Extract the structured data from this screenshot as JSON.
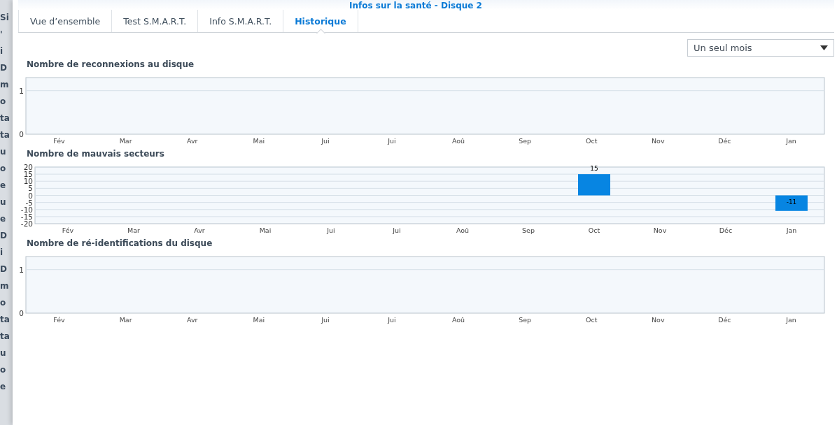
{
  "window": {
    "title": "Infos sur la santé - Disque 2"
  },
  "background_fragments": [
    "Si",
    "'",
    "i",
    "D",
    "m",
    "o",
    "ta",
    "ta",
    "u",
    "o",
    "e",
    "u",
    "e",
    "D",
    "i",
    "D",
    "m",
    "o",
    "ta",
    "ta",
    "u",
    "o",
    "e"
  ],
  "tabs": [
    {
      "label": "Vue d’ensemble",
      "selected": false
    },
    {
      "label": "Test S.M.A.R.T.",
      "selected": false
    },
    {
      "label": "Info S.M.A.R.T.",
      "selected": false
    },
    {
      "label": "Historique",
      "selected": true
    }
  ],
  "period_select": {
    "value": "Un seul mois"
  },
  "charts": [
    {
      "title": "Nombre de reconnexions au disque",
      "chart_data": {
        "type": "bar",
        "categories": [
          "Fév",
          "Mar",
          "Avr",
          "Mai",
          "Jui",
          "Jui",
          "Aoû",
          "Sep",
          "Oct",
          "Nov",
          "Déc",
          "Jan"
        ],
        "values": [
          null,
          null,
          null,
          null,
          null,
          null,
          null,
          null,
          null,
          null,
          null,
          null
        ],
        "ylim": [
          0,
          1.3
        ],
        "yticks": [
          0,
          1
        ],
        "grid": true
      }
    },
    {
      "title": "Nombre de mauvais secteurs",
      "chart_data": {
        "type": "bar",
        "categories": [
          "Fév",
          "Mar",
          "Avr",
          "Mai",
          "Jui",
          "Jui",
          "Aoû",
          "Sep",
          "Oct",
          "Nov",
          "Déc",
          "Jan"
        ],
        "values": [
          null,
          null,
          null,
          null,
          null,
          null,
          null,
          null,
          15,
          null,
          null,
          -11
        ],
        "ylim": [
          -20,
          20
        ],
        "yticks": [
          -20,
          -15,
          -10,
          -5,
          0,
          5,
          10,
          15,
          20
        ],
        "data_labels": true,
        "grid": true
      }
    },
    {
      "title": "Nombre de ré-identifications du disque",
      "chart_data": {
        "type": "bar",
        "categories": [
          "Fév",
          "Mar",
          "Avr",
          "Mai",
          "Jui",
          "Jui",
          "Aoû",
          "Sep",
          "Oct",
          "Nov",
          "Déc",
          "Jan"
        ],
        "values": [
          null,
          null,
          null,
          null,
          null,
          null,
          null,
          null,
          null,
          null,
          null,
          null
        ],
        "ylim": [
          0,
          1.3
        ],
        "yticks": [
          0,
          1
        ],
        "grid": true
      }
    }
  ]
}
